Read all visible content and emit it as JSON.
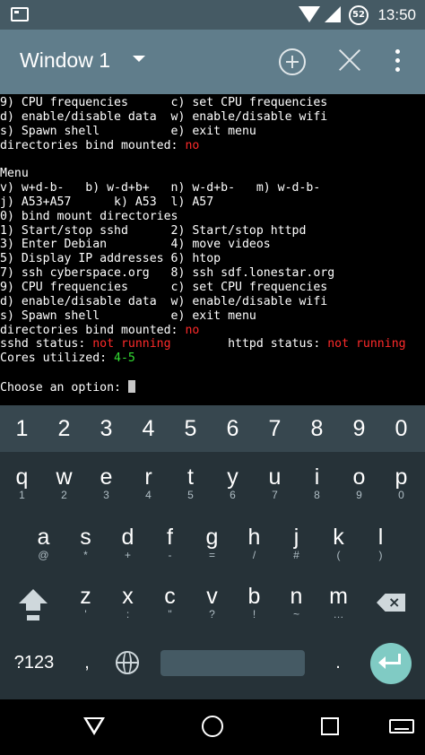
{
  "status_bar": {
    "time": "13:50",
    "notification_badge": "52",
    "icons": [
      "screen-icon",
      "wifi-icon",
      "cell-signal-icon",
      "battery-icon"
    ]
  },
  "toolbar": {
    "title": "Window 1"
  },
  "terminal": {
    "lines": [
      [
        {
          "t": "9) CPU frequencies      c) set CPU frequencies"
        }
      ],
      [
        {
          "t": "d) enable/disable data  w) enable/disable wifi"
        }
      ],
      [
        {
          "t": "s) Spawn shell          e) exit menu"
        }
      ],
      [
        {
          "t": "directories bind mounted: "
        },
        {
          "t": "no",
          "c": "red"
        }
      ],
      [
        {
          "t": ""
        }
      ],
      [
        {
          "t": "Menu"
        }
      ],
      [
        {
          "t": "v) w+d-b-   b) w-d+b+   n) w-d+b-   m) w-d-b-"
        }
      ],
      [
        {
          "t": "j) A53+A57      k) A53  l) A57"
        }
      ],
      [
        {
          "t": "0) bind mount directories"
        }
      ],
      [
        {
          "t": "1) Start/stop sshd      2) Start/stop httpd"
        }
      ],
      [
        {
          "t": "3) Enter Debian         4) move videos"
        }
      ],
      [
        {
          "t": "5) Display IP addresses 6) htop"
        }
      ],
      [
        {
          "t": "7) ssh cyberspace.org   8) ssh sdf.lonestar.org"
        }
      ],
      [
        {
          "t": "9) CPU frequencies      c) set CPU frequencies"
        }
      ],
      [
        {
          "t": "d) enable/disable data  w) enable/disable wifi"
        }
      ],
      [
        {
          "t": "s) Spawn shell          e) exit menu"
        }
      ],
      [
        {
          "t": "directories bind mounted: "
        },
        {
          "t": "no",
          "c": "red"
        }
      ],
      [
        {
          "t": "sshd status: "
        },
        {
          "t": "not running",
          "c": "red"
        },
        {
          "t": "        httpd status: "
        },
        {
          "t": "not running",
          "c": "red"
        }
      ],
      [
        {
          "t": "Cores utilized: "
        },
        {
          "t": "4-5",
          "c": "green"
        }
      ],
      [
        {
          "t": ""
        }
      ],
      [
        {
          "t": "Choose an option: "
        },
        {
          "cursor": true
        }
      ]
    ]
  },
  "keyboard": {
    "numbers": [
      "1",
      "2",
      "3",
      "4",
      "5",
      "6",
      "7",
      "8",
      "9",
      "0"
    ],
    "row1": [
      {
        "k": "q",
        "s": "1"
      },
      {
        "k": "w",
        "s": "2"
      },
      {
        "k": "e",
        "s": "3"
      },
      {
        "k": "r",
        "s": "4"
      },
      {
        "k": "t",
        "s": "5"
      },
      {
        "k": "y",
        "s": "6"
      },
      {
        "k": "u",
        "s": "7"
      },
      {
        "k": "i",
        "s": "8"
      },
      {
        "k": "o",
        "s": "9"
      },
      {
        "k": "p",
        "s": "0"
      }
    ],
    "row2": [
      {
        "k": "a",
        "s": "@"
      },
      {
        "k": "s",
        "s": "*"
      },
      {
        "k": "d",
        "s": "+"
      },
      {
        "k": "f",
        "s": "-"
      },
      {
        "k": "g",
        "s": "="
      },
      {
        "k": "h",
        "s": "/"
      },
      {
        "k": "j",
        "s": "#"
      },
      {
        "k": "k",
        "s": "("
      },
      {
        "k": "l",
        "s": ")"
      }
    ],
    "row3": [
      {
        "k": "z",
        "s": "'"
      },
      {
        "k": "x",
        "s": ":"
      },
      {
        "k": "c",
        "s": "\""
      },
      {
        "k": "v",
        "s": "?"
      },
      {
        "k": "b",
        "s": "!"
      },
      {
        "k": "n",
        "s": "~"
      },
      {
        "k": "m",
        "s": "…"
      }
    ],
    "symbols_label": "?123",
    "comma": ",",
    "period": "."
  }
}
